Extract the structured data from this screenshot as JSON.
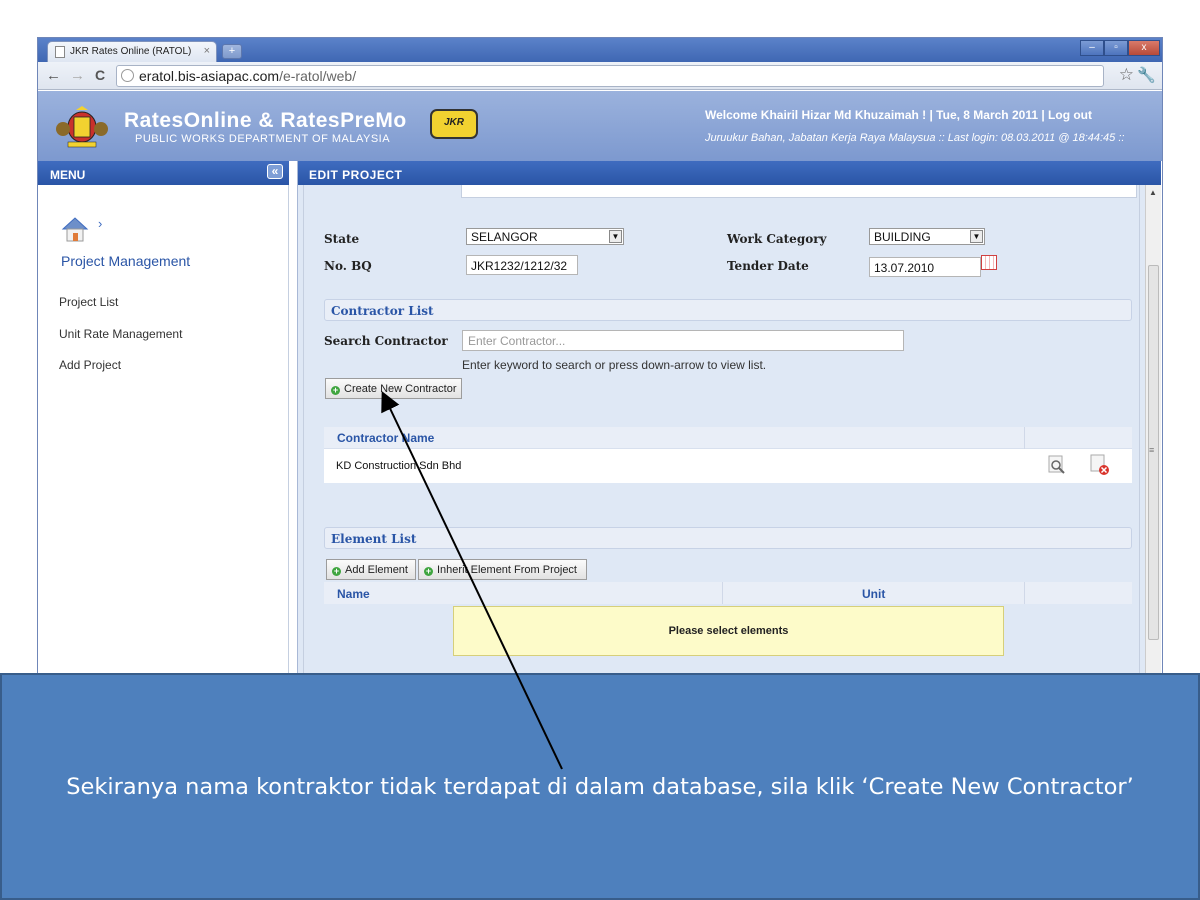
{
  "browser": {
    "tab_title": "JKR Rates Online (RATOL)",
    "tab_close": "×",
    "new_tab": "+",
    "url_domain": "eratol.bis-asiapac.com",
    "url_path": "/e-ratol/web/",
    "nav_back": "←",
    "nav_forward": "→",
    "nav_reload": "C",
    "win_min": "–",
    "win_max": "▫",
    "win_close": "x"
  },
  "header": {
    "title": "RatesOnline & RatesPreMo",
    "subtitle": "PUBLIC WORKS DEPARTMENT OF MALAYSIA",
    "jkr_logo_text": "JKR",
    "welcome": "Welcome Khairil Hizar Md Khuzaimah ! | Tue, 8 March 2011 | Log out",
    "last_login": "Juruukur Bahan, Jabatan Kerja Raya Malaysua :: Last login: 08.03.2011 @ 18:44:45 ::"
  },
  "sidebar": {
    "menu_label": "MENU",
    "collapse_glyph": "«",
    "breadcrumb_chevron": "›",
    "section_title": "Project Management",
    "links": [
      "Project List",
      "Unit Rate Management",
      "Add Project"
    ]
  },
  "main": {
    "panel_title": "EDIT PROJECT",
    "state_label": "State",
    "state_value": "SELANGOR",
    "no_bq_label": "No. BQ",
    "no_bq_value": "JKR1232/1212/32",
    "work_category_label": "Work Category",
    "work_category_value": "BUILDING",
    "tender_date_label": "Tender Date",
    "tender_date_value": "13.07.2010",
    "contractor_section": "Contractor List",
    "search_label": "Search Contractor",
    "search_placeholder": "Enter Contractor...",
    "search_hint": "Enter keyword to search or press down-arrow to view list.",
    "create_contractor_button": "Create New Contractor",
    "contractor_table": {
      "header_name": "Contractor Name",
      "rows": [
        {
          "name": "KD Construction Sdn Bhd"
        }
      ]
    },
    "element_section": "Element List",
    "add_element_button": "Add Element",
    "inherit_element_button": "Inherit Element From Project",
    "element_table": {
      "header_name": "Name",
      "header_unit": "Unit",
      "empty_message": "Please select elements"
    }
  },
  "caption": {
    "text": "Sekiranya nama kontraktor tidak terdapat di dalam database, sila klik ‘Create New Contractor’"
  },
  "colors": {
    "header_bar": "#2a55a6",
    "caption_bg": "#4e80bd",
    "app_header": "#8aa5d6",
    "notice_bg": "#fdfbc9"
  }
}
